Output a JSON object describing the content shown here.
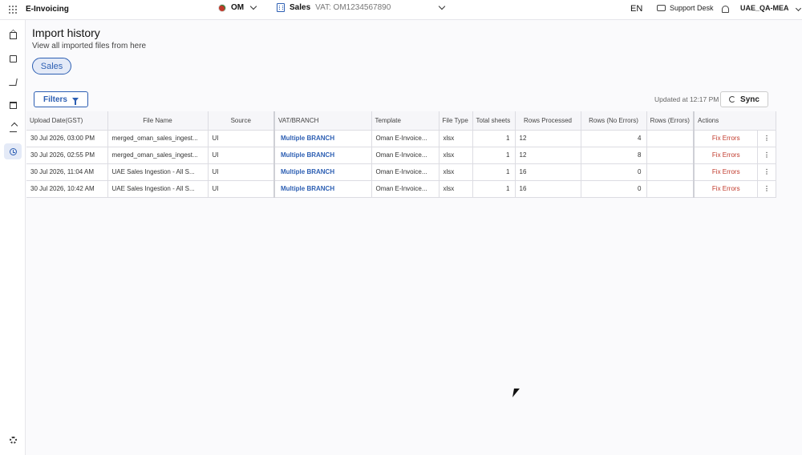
{
  "app": {
    "title": "E-Invoicing"
  },
  "header": {
    "country_code": "OM",
    "entity_name": "Sales",
    "entity_vat": "VAT: OM1234567890",
    "language": "EN",
    "support_label": "Support Desk",
    "user": "UAE_QA-MEA"
  },
  "page": {
    "title": "Import history",
    "subtitle": "View all imported files from here",
    "chip_label": "Sales",
    "filters_label": "Filters",
    "updated_text": "Updated at 12:17 PM",
    "sync_label": "Sync"
  },
  "table": {
    "columns": [
      "Upload Date(GST)",
      "File Name",
      "Source",
      "VAT/BRANCH",
      "Template",
      "File Type",
      "Total sheets",
      "Rows Processed",
      "Rows (No Errors)",
      "Rows (Errors)",
      "Actions"
    ],
    "rows": [
      {
        "date": "30 Jul 2026, 03:00 PM",
        "file": "merged_oman_sales_ingest...",
        "source": "UI",
        "branch": "Multiple BRANCH",
        "template": "Oman E-Invoice...",
        "type": "xlsx",
        "sheets": "1",
        "processed": "12",
        "no_errors": "4",
        "errors": "",
        "action": "Fix Errors",
        "more": "⋮"
      },
      {
        "date": "30 Jul 2026, 02:55 PM",
        "file": "merged_oman_sales_ingest...",
        "source": "UI",
        "branch": "Multiple BRANCH",
        "template": "Oman E-Invoice...",
        "type": "xlsx",
        "sheets": "1",
        "processed": "12",
        "no_errors": "8",
        "errors": "",
        "action": "Fix Errors",
        "more": "⋮"
      },
      {
        "date": "30 Jul 2026, 11:04 AM",
        "file": "UAE Sales Ingestion - All S...",
        "source": "UI",
        "branch": "Multiple BRANCH",
        "template": "Oman E-Invoice...",
        "type": "xlsx",
        "sheets": "1",
        "processed": "16",
        "no_errors": "0",
        "errors": "",
        "action": "Fix Errors",
        "more": "⋮"
      },
      {
        "date": "30 Jul 2026, 10:42 AM",
        "file": "UAE Sales Ingestion - All S...",
        "source": "UI",
        "branch": "Multiple BRANCH",
        "template": "Oman E-Invoice...",
        "type": "xlsx",
        "sheets": "1",
        "processed": "16",
        "no_errors": "0",
        "errors": "",
        "action": "Fix Errors",
        "more": "⋮"
      }
    ]
  },
  "sidebar": {
    "items": [
      {
        "icon": "home-icon"
      },
      {
        "icon": "book-icon"
      },
      {
        "icon": "cart-icon"
      },
      {
        "icon": "bank-icon"
      },
      {
        "icon": "upload-icon"
      },
      {
        "icon": "history-icon",
        "active": true
      },
      {
        "icon": "gear-icon"
      }
    ]
  },
  "colors": {
    "accent": "#2d5fb3",
    "error": "#c0392b",
    "chip_bg": "#e4eaf7"
  }
}
